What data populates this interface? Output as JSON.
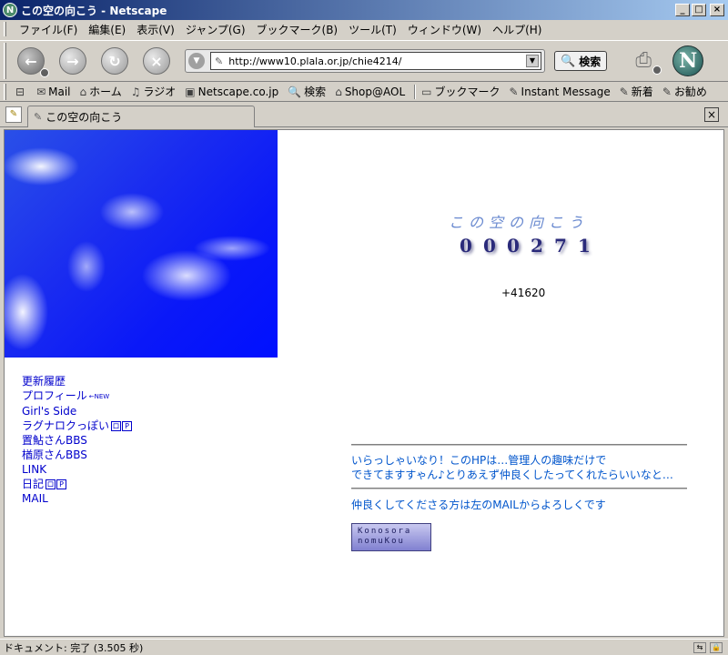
{
  "window": {
    "title": "この空の向こう - Netscape",
    "app_icon": "netscape-app-icon"
  },
  "menu": [
    "ファイル(F)",
    "編集(E)",
    "表示(V)",
    "ジャンプ(G)",
    "ブックマーク(B)",
    "ツール(T)",
    "ウィンドウ(W)",
    "ヘルプ(H)"
  ],
  "navigation": {
    "url": "http://www10.plala.or.jp/chie4214/",
    "search_label": "検索"
  },
  "personal_toolbar": [
    "Mail",
    "ホーム",
    "ラジオ",
    "Netscape.co.jp",
    "検索",
    "Shop@AOL",
    "ブックマーク",
    "Instant Message",
    "新着",
    "お勧め"
  ],
  "tab": {
    "label": "この空の向こう"
  },
  "page": {
    "site_title": "この空の向こう",
    "counter_digits": [
      "0",
      "0",
      "0",
      "2",
      "7",
      "1"
    ],
    "counter_extra": "+41620",
    "nav_links": [
      {
        "label": "更新履歴"
      },
      {
        "label": "プロフィール",
        "new": "←NEW"
      },
      {
        "label": "Girl's Side"
      },
      {
        "label": "ラグナロクっぽい",
        "badges": [
          "ロ",
          "P"
        ]
      },
      {
        "label": "置鮎さんBBS"
      },
      {
        "label": "楢原さんBBS"
      },
      {
        "label": "LINK"
      },
      {
        "label": "日記",
        "badges": [
          "ロ",
          "P"
        ]
      },
      {
        "label": "MAIL"
      }
    ],
    "message_lines": [
      "いらっしゃいなり！このHPは…管理人の趣味だけで",
      "できてますすゃん♪とりあえず仲良くしたってくれたらいいなと…"
    ],
    "message2": "仲良くしてくださる方は左のMAILからよろしくです",
    "banner_lines": [
      "Konosora",
      "nomuKou"
    ]
  },
  "status": {
    "text": "ドキュメント: 完了 (3.505 秒)"
  }
}
